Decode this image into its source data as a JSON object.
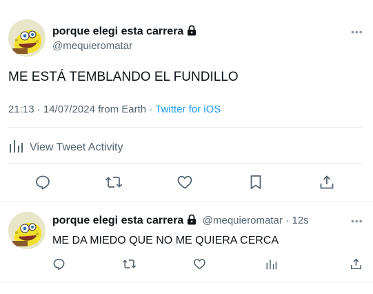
{
  "tweet": {
    "author_name": "porque elegi esta carrera",
    "author_handle": "@mequieromatar",
    "text": "ME ESTÁ TEMBLANDO EL FUNDILLO",
    "time": "21:13 · 14/07/2024",
    "location_prefix": "from",
    "location": "Earth",
    "separator": "·",
    "client": "Twitter for iOS",
    "activity_label": "View Tweet Activity"
  },
  "reply": {
    "author_name": "porque elegi esta carrera",
    "author_handle": "@mequieromatar",
    "age": "· 12s",
    "text": "ME DA MIEDO QUE NO ME QUIERA CERCA"
  },
  "icons": {
    "more": "more-icon",
    "lock": "lock-icon",
    "activity": "bar-chart-icon",
    "reply": "reply-icon",
    "retweet": "retweet-icon",
    "like": "heart-icon",
    "bookmark": "bookmark-icon",
    "share": "share-icon"
  },
  "colors": {
    "text": "#0f1419",
    "secondary": "#536471",
    "link": "#1d9bf0",
    "divider": "#e6ecf0"
  }
}
